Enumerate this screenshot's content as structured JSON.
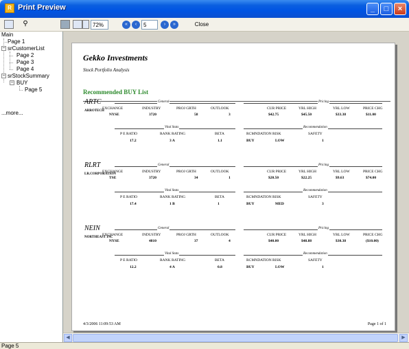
{
  "window": {
    "title": "Print Preview",
    "icon_label": "R"
  },
  "toolbar": {
    "zoom": "72%",
    "page_number": "5",
    "close_label": "Close"
  },
  "tree": {
    "items": [
      {
        "label": "Main"
      },
      {
        "label": "Page 1"
      },
      {
        "label": "srCustomerList",
        "expander": "−"
      },
      {
        "label": "Page 2"
      },
      {
        "label": "Page 3"
      },
      {
        "label": "Page 4"
      },
      {
        "label": "srStockSummary",
        "expander": "−"
      },
      {
        "label": "BUY",
        "expander": "−"
      },
      {
        "label": "Page 5"
      },
      {
        "label": "...more..."
      }
    ]
  },
  "report": {
    "company": "Gekko Investments",
    "subtitle": "Stock Portfolio Analysis",
    "section": "Recommended BUY List",
    "group_labels": {
      "general": "General",
      "pricing": "Pricing",
      "vital": "Vital Stats",
      "recommendation": "Recommendation"
    },
    "headers": {
      "exchange": "EXCHANGE",
      "industry": "INDUSTRY",
      "growth": "PROJ GRTH",
      "outlook": "OUTLOOK",
      "cur_price": "CUR PRICE",
      "yrl_high": "YRL HIGH",
      "yrl_low": "YRL LOW",
      "price_chg": "PRICE CHG",
      "pe_ratio": "P E RATIO",
      "rank_rating": "RANK RATING",
      "beta": "BETA",
      "rcmnd": "RCMNDATION RISK",
      "safety": "SAFETY"
    },
    "stocks": [
      {
        "symbol": "ARTC",
        "name": "ARROTECH",
        "exchange": "NYSE",
        "industry": "3720",
        "growth": "58",
        "outlook": "3",
        "cur_price": "$42.75",
        "yrl_high": "$45.50",
        "yrl_low": "$33.38",
        "price_chg": "$11.00",
        "pe_ratio": "17.2",
        "rank_rating": "3 A",
        "beta": "1.1",
        "recommendation": "BUY",
        "risk": "LOW",
        "safety": "1"
      },
      {
        "symbol": "RLRT",
        "name": "LR.CORPORATION",
        "exchange": "TSE",
        "industry": "3720",
        "growth": "34",
        "outlook": "1",
        "cur_price": "$20.50",
        "yrl_high": "$22.25",
        "yrl_low": "$9.63",
        "price_chg": "$74.00",
        "pe_ratio": "17.4",
        "rank_rating": "1 B",
        "beta": "1",
        "recommendation": "BUY",
        "risk": "MED",
        "safety": "3"
      },
      {
        "symbol": "NEIN",
        "name": "NORTHEAST INC",
        "exchange": "NYSE",
        "industry": "4810",
        "growth": "37",
        "outlook": "4",
        "cur_price": "$40.00",
        "yrl_high": "$48.88",
        "yrl_low": "$30.38",
        "price_chg": "($10.00)",
        "pe_ratio": "12.2",
        "rank_rating": "4 A",
        "beta": "0.8",
        "recommendation": "BUY",
        "risk": "LOW",
        "safety": "1"
      }
    ],
    "footer_date": "4/3/2006 11:09:53 AM",
    "footer_page": "Page 1 of 1"
  },
  "status": {
    "text": "Page 5"
  }
}
